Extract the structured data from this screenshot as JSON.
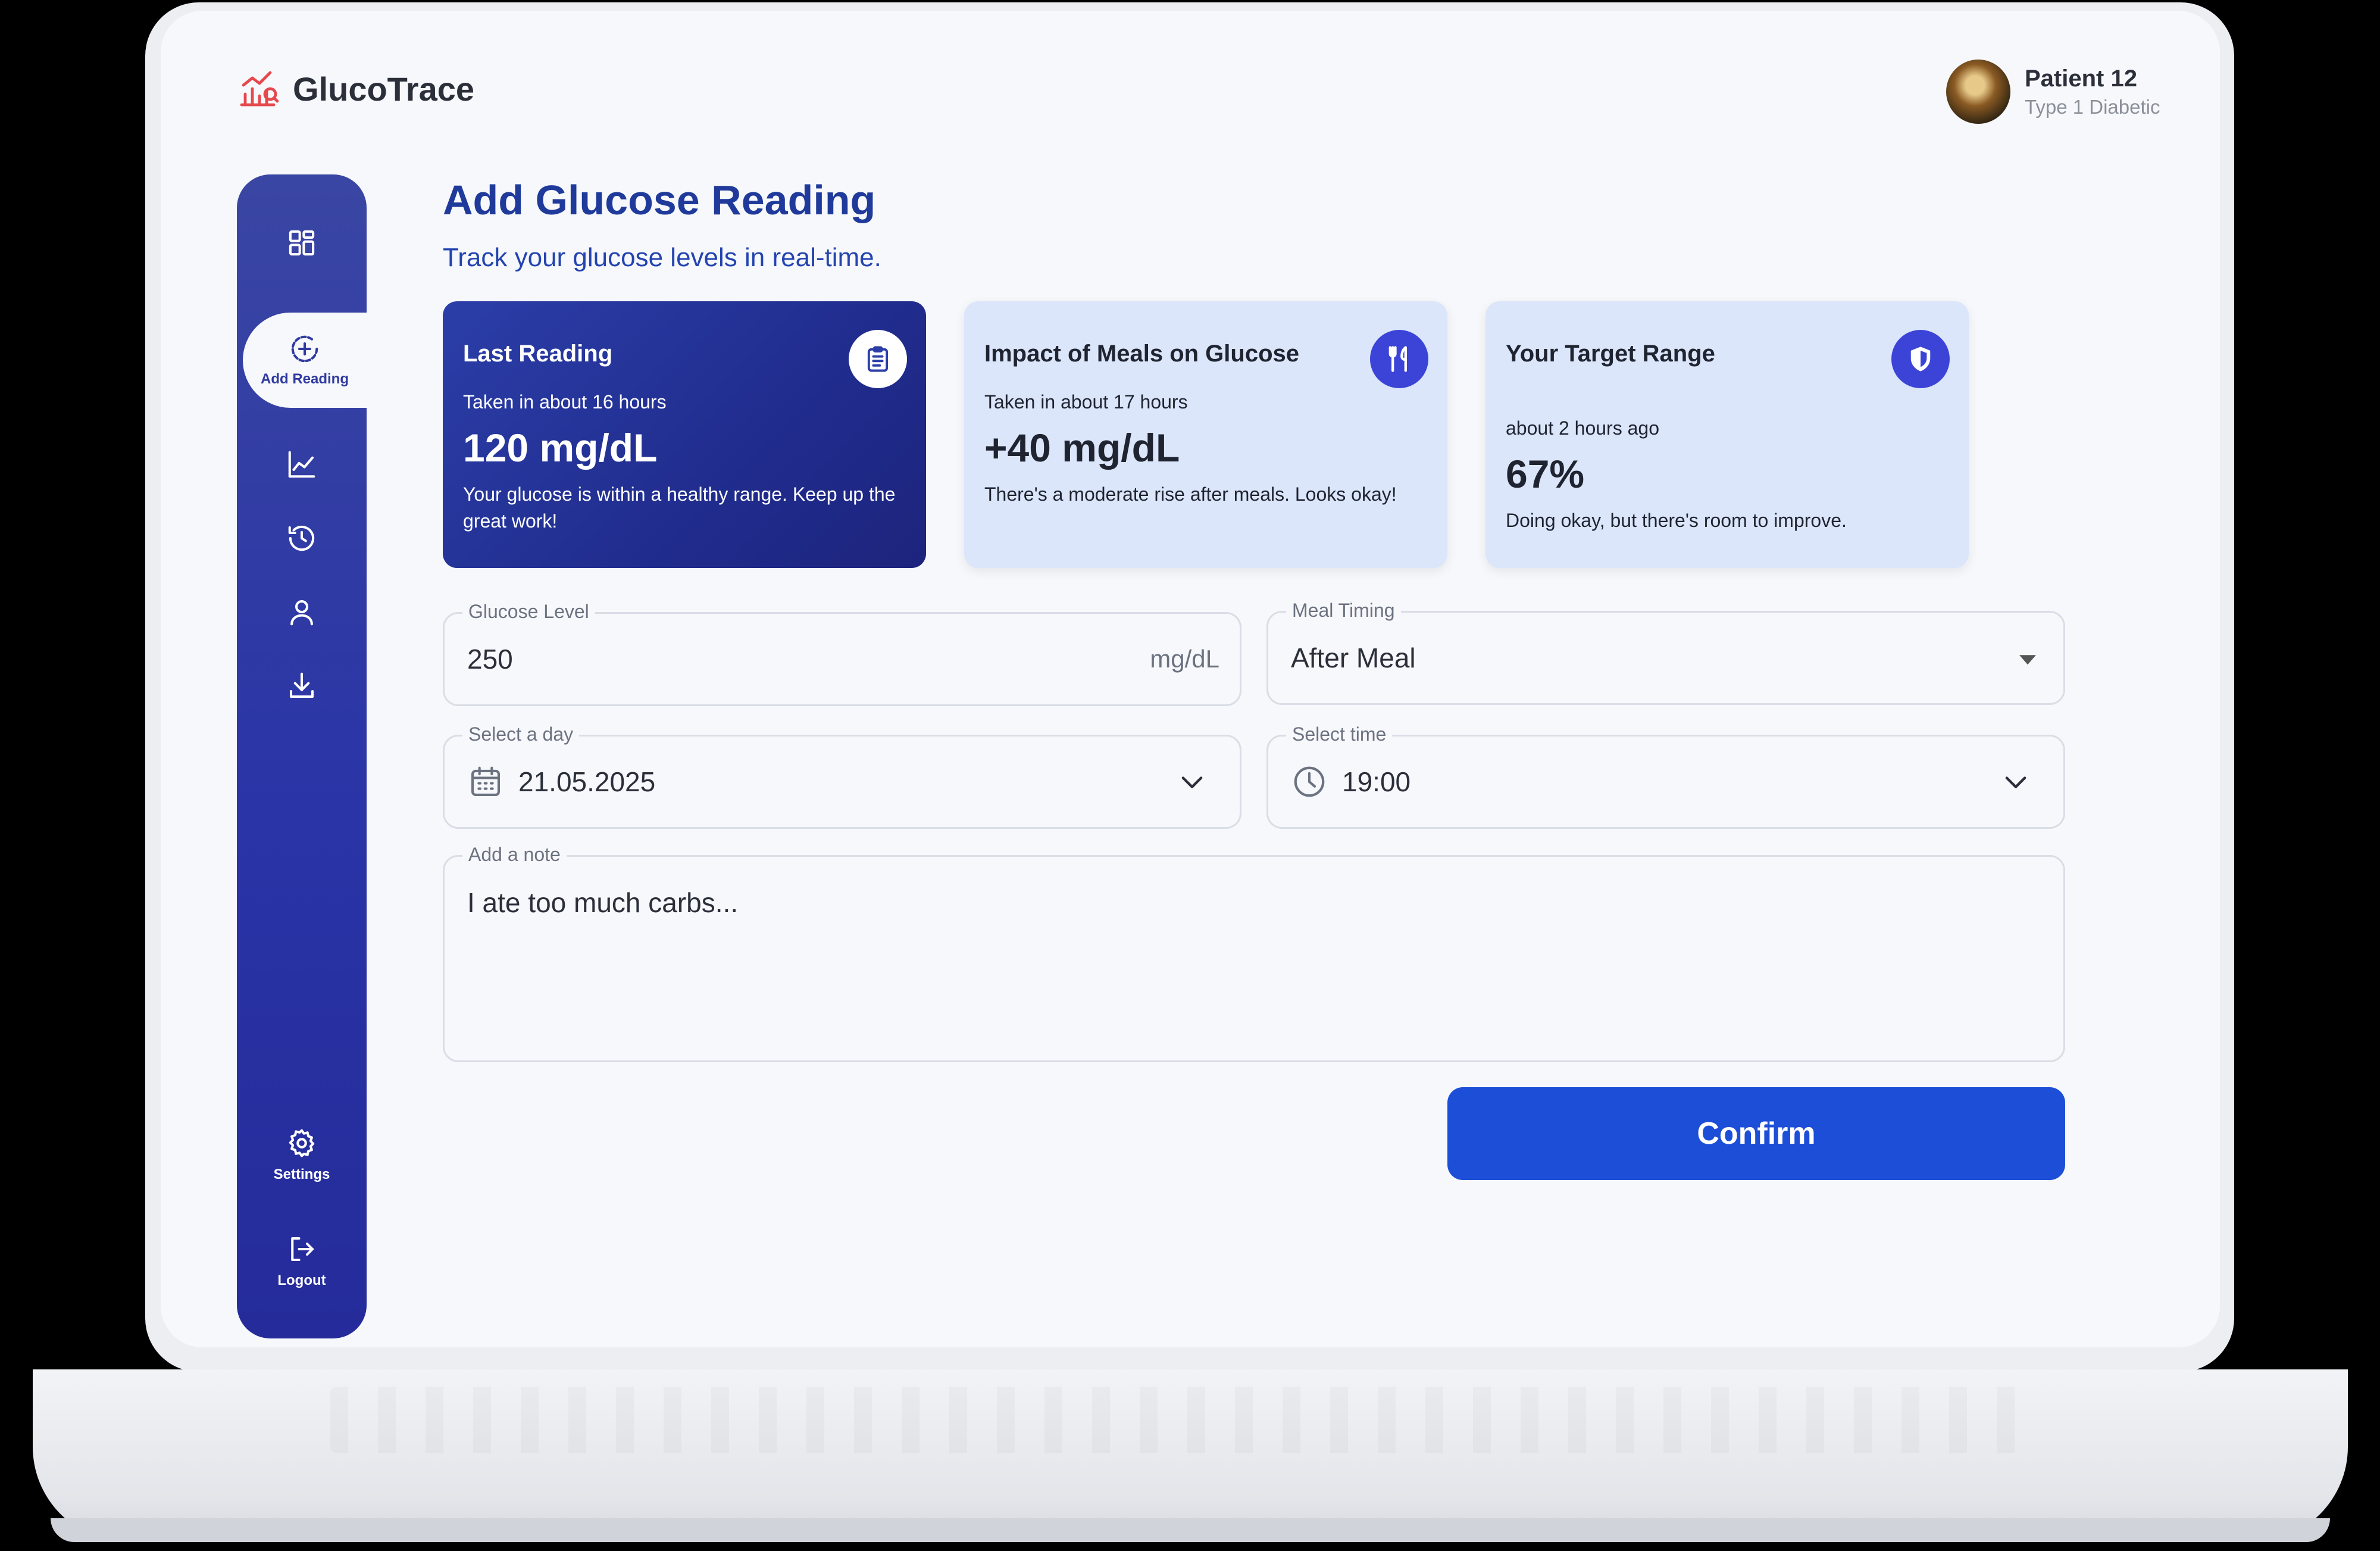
{
  "app": {
    "name": "GlucoTrace"
  },
  "user": {
    "name": "Patient 12",
    "subtitle": "Type 1 Diabetic"
  },
  "sidebar": {
    "items": [
      {
        "icon": "dashboard-icon",
        "label": ""
      },
      {
        "icon": "add-circle-icon",
        "label": "Add Reading",
        "active": true
      },
      {
        "icon": "chart-icon",
        "label": ""
      },
      {
        "icon": "history-icon",
        "label": ""
      },
      {
        "icon": "profile-icon",
        "label": ""
      },
      {
        "icon": "download-icon",
        "label": ""
      }
    ],
    "settings_label": "Settings",
    "logout_label": "Logout"
  },
  "page": {
    "title": "Add Glucose Reading",
    "subtitle": "Track your glucose levels in real-time."
  },
  "cards": [
    {
      "title": "Last Reading",
      "subtitle": "Taken in about 16 hours",
      "value": "120 mg/dL",
      "description": "Your glucose is within a healthy range. Keep up the great work!",
      "icon": "clipboard-icon"
    },
    {
      "title": "Impact of Meals on Glucose",
      "subtitle": "Taken in about 17 hours",
      "value": "+40 mg/dL",
      "description": "There's a moderate rise after meals. Looks okay!",
      "icon": "utensils-icon"
    },
    {
      "title": "Your Target Range",
      "subtitle": "about 2 hours ago",
      "value": "67%",
      "description": "Doing okay, but there's room to improve.",
      "icon": "shield-icon"
    }
  ],
  "form": {
    "glucose": {
      "label": "Glucose Level",
      "value": "250",
      "unit": "mg/dL"
    },
    "meal_timing": {
      "label": "Meal Timing",
      "value": "After Meal"
    },
    "day": {
      "label": "Select a day",
      "value": "21.05.2025"
    },
    "time": {
      "label": "Select time",
      "value": "19:00"
    },
    "note": {
      "label": "Add a note",
      "value": "I ate too much carbs..."
    },
    "confirm_label": "Confirm"
  },
  "colors": {
    "primary": "#1d4ed8",
    "sidebar": "#2a34a6",
    "title": "#1f3a9a",
    "card_light": "#dbe6fb",
    "logo_red": "#e5484d"
  }
}
